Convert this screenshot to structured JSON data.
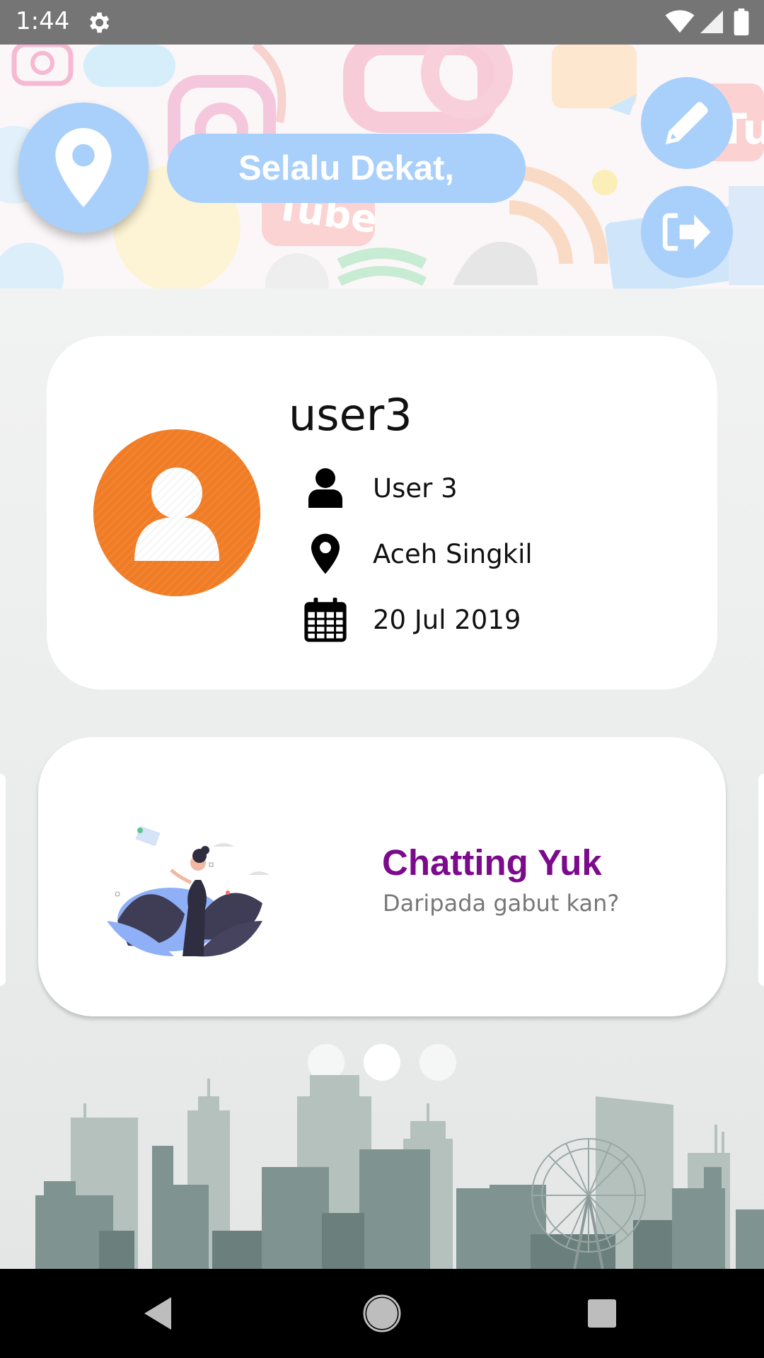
{
  "status_bar": {
    "time": "1:44",
    "icons": [
      "gear-icon",
      "wifi-icon",
      "signal-icon",
      "battery-icon"
    ]
  },
  "header": {
    "greeting": "Selalu Dekat,",
    "buttons": [
      "location-pin-icon",
      "pencil-icon",
      "logout-icon"
    ],
    "accent_color": "#a9d0fb"
  },
  "profile": {
    "username": "user3",
    "full_name": "User 3",
    "location": "Aceh Singkil",
    "join_date": "20 Jul 2019",
    "avatar_color": "#f07d26"
  },
  "carousel": {
    "title": "Chatting Yuk",
    "subtitle": "Daripada gabut kan?",
    "title_color": "#7c0a8c",
    "page_count": 3,
    "active_page": 1
  },
  "nav_bar": {
    "icons": [
      "back-icon",
      "home-icon",
      "recents-icon"
    ]
  }
}
